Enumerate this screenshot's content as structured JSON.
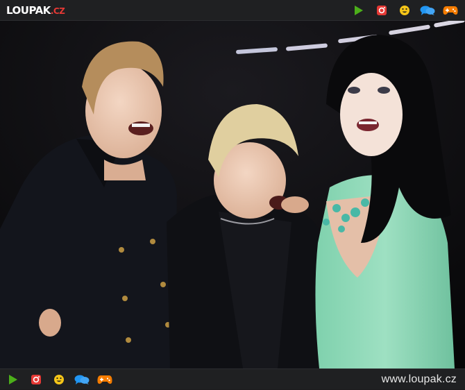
{
  "header": {
    "logo_main": "LOUPAK",
    "logo_tld": ".CZ",
    "icons": [
      "play-icon",
      "instagram-icon",
      "smiley-icon",
      "chat-icon",
      "gamepad-icon"
    ]
  },
  "footer": {
    "url": "www.loupak.cz",
    "icons": [
      "play-icon",
      "instagram-icon",
      "smiley-icon",
      "chat-icon",
      "gamepad-icon"
    ]
  },
  "colors": {
    "bar_bg": "#1f2022",
    "play_green": "#4caf1a",
    "instagram_red": "#e53935",
    "smiley_yellow": "#f5c518",
    "chat_blue": "#2196f3",
    "gamepad_orange": "#f57c00"
  }
}
